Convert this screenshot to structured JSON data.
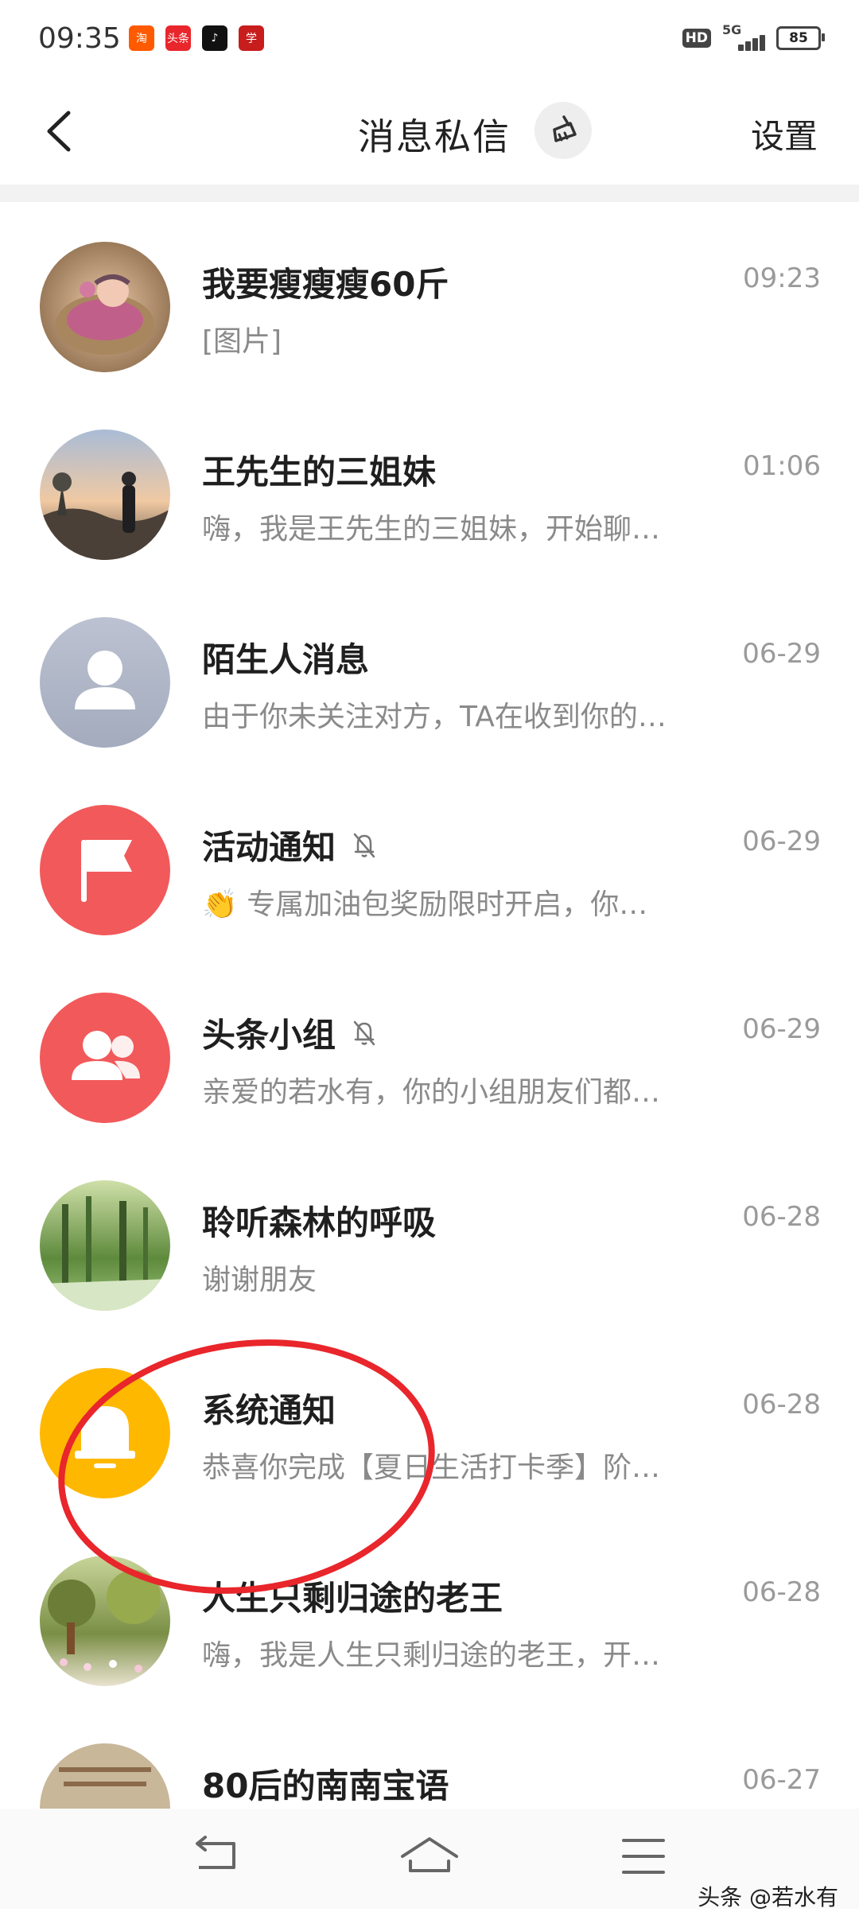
{
  "status_bar": {
    "time": "09:35",
    "apps": [
      {
        "name": "taobao-app-icon",
        "label": "淘",
        "color": "#ff5a00"
      },
      {
        "name": "toutiao-app-icon",
        "label": "头条",
        "color": "#e8262b"
      },
      {
        "name": "tiktok-app-icon",
        "label": "♪",
        "color": "#111111"
      },
      {
        "name": "xuexi-app-icon",
        "label": "学",
        "color": "#c81d1d"
      }
    ],
    "hd": "HD",
    "network": "5G",
    "battery": "85"
  },
  "header": {
    "title": "消息私信",
    "settings_label": "设置"
  },
  "conversations": [
    {
      "name": "我要瘦瘦瘦60斤",
      "time": "09:23",
      "preview": "[图片]",
      "muted": false,
      "avatar": "photo-baby"
    },
    {
      "name": "王先生的三姐妹",
      "time": "01:06",
      "preview": "嗨，我是王先生的三姐妹，开始聊…",
      "muted": false,
      "avatar": "photo-sunset"
    },
    {
      "name": "陌生人消息",
      "time": "06-29",
      "preview": "由于你未关注对方，TA在收到你的…",
      "muted": false,
      "avatar": "person-icon"
    },
    {
      "name": "活动通知",
      "time": "06-29",
      "preview": "👏 专属加油包奖励限时开启，你…",
      "muted": true,
      "avatar": "flag-icon"
    },
    {
      "name": "头条小组",
      "time": "06-29",
      "preview": "亲爱的若水有，你的小组朋友们都…",
      "muted": true,
      "avatar": "group-icon"
    },
    {
      "name": "聆听森林的呼吸",
      "time": "06-28",
      "preview": "谢谢朋友",
      "muted": false,
      "avatar": "photo-forest"
    },
    {
      "name": "系统通知",
      "time": "06-28",
      "preview": "恭喜你完成【夏日生活打卡季】阶…",
      "muted": false,
      "avatar": "bell-icon"
    },
    {
      "name": "人生只剩归途的老王",
      "time": "06-28",
      "preview": "嗨，我是人生只剩归途的老王，开…",
      "muted": false,
      "avatar": "photo-garden"
    },
    {
      "name": "80后的南南宝语",
      "time": "06-27",
      "preview": "",
      "muted": false,
      "avatar": "photo-text"
    }
  ],
  "watermark": "头条 @若水有"
}
